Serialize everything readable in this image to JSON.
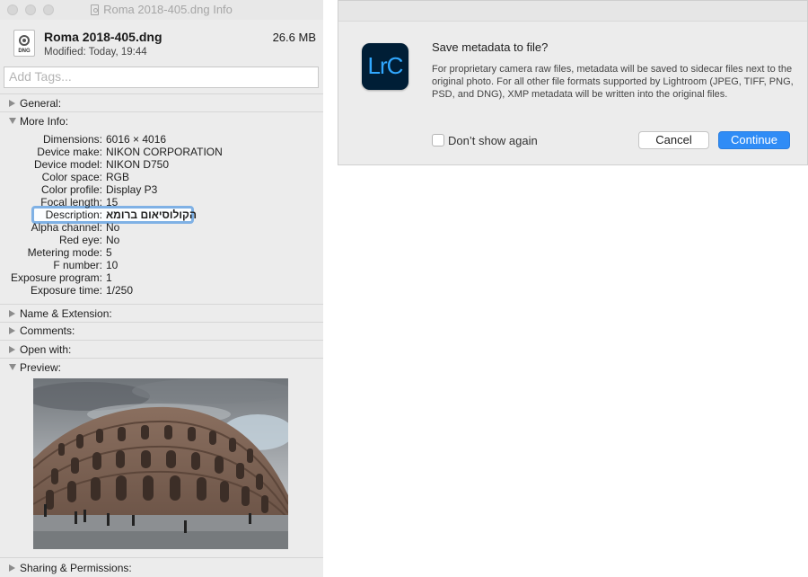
{
  "info_window": {
    "title": "Roma 2018-405.dng Info",
    "file_name": "Roma 2018-405.dng",
    "file_size": "26.6 MB",
    "modified": "Modified: Today, 19:44",
    "file_icon_ext": "DNG",
    "tags_placeholder": "Add Tags...",
    "sections": {
      "general": "General:",
      "more_info": "More Info:",
      "name_ext": "Name & Extension:",
      "comments": "Comments:",
      "open_with": "Open with:",
      "preview": "Preview:",
      "sharing": "Sharing & Permissions:"
    },
    "more_info": [
      {
        "key": "Dimensions:",
        "value": "6016 × 4016"
      },
      {
        "key": "Device make:",
        "value": "NIKON CORPORATION"
      },
      {
        "key": "Device model:",
        "value": "NIKON D750"
      },
      {
        "key": "Color space:",
        "value": "RGB"
      },
      {
        "key": "Color profile:",
        "value": "Display P3"
      },
      {
        "key": "Focal length:",
        "value": "15"
      },
      {
        "key": "Description:",
        "value": "הקולוסיאום ברומא"
      },
      {
        "key": "Alpha channel:",
        "value": "No"
      },
      {
        "key": "Red eye:",
        "value": "No"
      },
      {
        "key": "Metering mode:",
        "value": "5"
      },
      {
        "key": "F number:",
        "value": "10"
      },
      {
        "key": "Exposure program:",
        "value": "1"
      },
      {
        "key": "Exposure time:",
        "value": "1/250"
      }
    ]
  },
  "dialog": {
    "app_icon_text": "LrC",
    "title": "Save metadata to file?",
    "body": "For proprietary camera raw files, metadata will be saved to sidecar files next to the original photo. For all other file formats supported by Lightroom (JPEG, TIFF, PNG, PSD, and DNG), XMP metadata will be written into the original files.",
    "dont_show_again": "Don’t show again",
    "cancel_label": "Cancel",
    "continue_label": "Continue",
    "accent_color": "#2f8cf6"
  }
}
